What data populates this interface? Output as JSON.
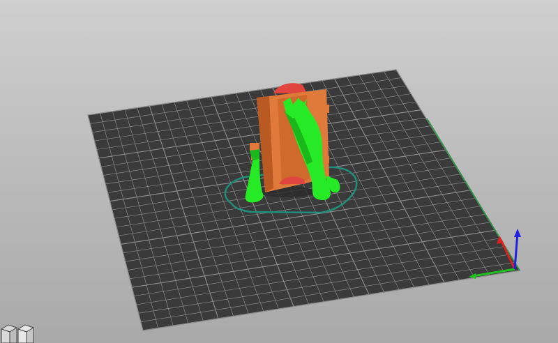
{
  "app": {
    "view": "3D bed preview"
  },
  "colors": {
    "background_top": "#cfcfcf",
    "background_bottom": "#a9a9a9",
    "bed_fill": "#3a3a3a",
    "grid_line": "#8a8a8a",
    "model_orange": "#e07a3a",
    "model_orange_shadow": "#b85a22",
    "model_red": "#e0453f",
    "support_green": "#27ea27",
    "support_green_dark": "#1bb81b",
    "skirt_outline": "#1f8f7a",
    "axis_x": "#e02020",
    "axis_y": "#20c020",
    "axis_z": "#2020e0"
  },
  "bed": {
    "grid_divisions": 25
  },
  "icons": {
    "view_cube": "cube-view-icon",
    "axes": "xyz-axes-icon"
  }
}
